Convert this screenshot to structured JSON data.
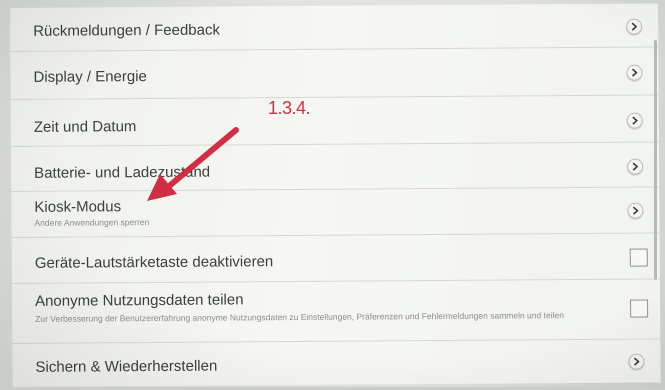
{
  "settings": {
    "items": [
      {
        "title": "Rückmeldungen / Feedback",
        "type": "chevron"
      },
      {
        "title": "Display / Energie",
        "type": "chevron"
      },
      {
        "title": "Zeit und Datum",
        "type": "chevron"
      },
      {
        "title": "Batterie- und Ladezustand",
        "type": "chevron"
      },
      {
        "title": "Kiosk-Modus",
        "subtitle": "Andere Anwendungen sperren",
        "type": "chevron"
      },
      {
        "title": "Geräte-Lautstärketaste deaktivieren",
        "type": "checkbox",
        "checked": false
      },
      {
        "title": "Anonyme Nutzungsdaten teilen",
        "subtitle": "Zur Verbesserung der Benutzererfahrung anonyme Nutzungsdaten zu Einstellungen, Präferenzen und Fehlermeldungen sammeln und teilen",
        "type": "checkbox",
        "checked": false
      },
      {
        "title": "Sichern & Wiederherstellen",
        "type": "chevron"
      }
    ]
  },
  "annotation": {
    "label": "1.3.4.",
    "color": "#d12e43",
    "points_to": "Kiosk-Modus"
  },
  "icons": {
    "chevron": "chevron-right-icon",
    "checkbox": "checkbox-icon"
  }
}
